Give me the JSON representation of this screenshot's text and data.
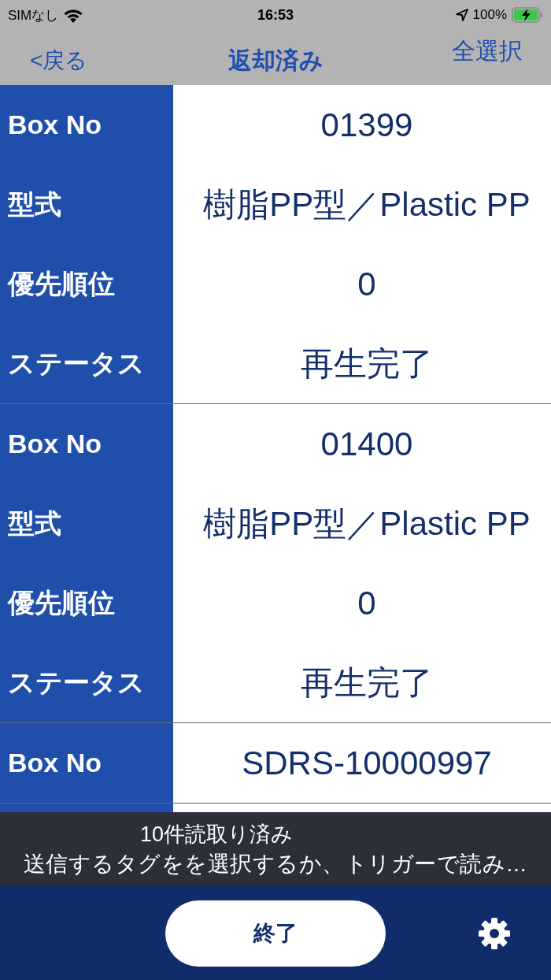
{
  "status_bar": {
    "carrier": "SIMなし",
    "time": "16:53",
    "battery": "100%"
  },
  "nav": {
    "back": "<戻る",
    "title": "返却済み",
    "action": "全選択"
  },
  "records": [
    {
      "fields": [
        {
          "label": "Box No",
          "value": "01399"
        },
        {
          "label": "型式",
          "value": "樹脂PP型／Plastic PP"
        },
        {
          "label": "優先順位",
          "value": "0"
        },
        {
          "label": "ステータス",
          "value": "再生完了"
        }
      ]
    },
    {
      "fields": [
        {
          "label": "Box No",
          "value": "01400"
        },
        {
          "label": "型式",
          "value": "樹脂PP型／Plastic PP"
        },
        {
          "label": "優先順位",
          "value": "0"
        },
        {
          "label": "ステータス",
          "value": "再生完了"
        }
      ]
    },
    {
      "fields": [
        {
          "label": "Box No",
          "value": "SDRS-10000997"
        }
      ]
    }
  ],
  "toast": {
    "title": "10件読取り済み",
    "message": "送信するタグをを選択するか、トリガーで読み…"
  },
  "footer": {
    "button": "終了"
  }
}
